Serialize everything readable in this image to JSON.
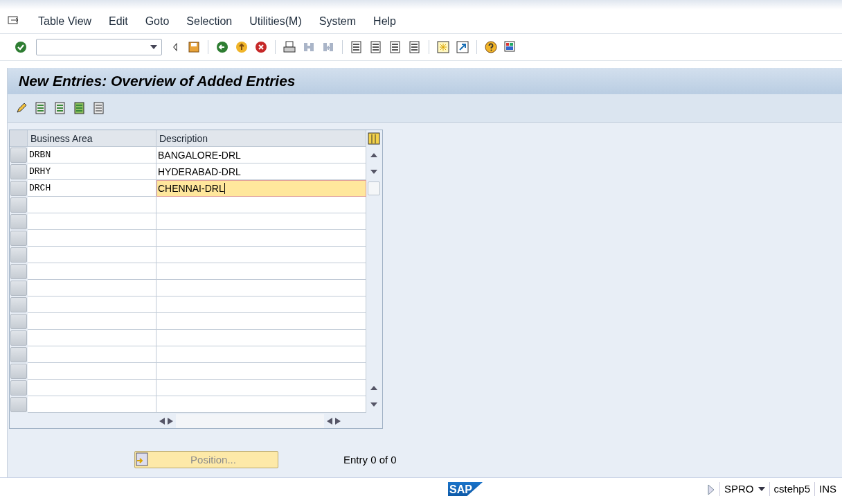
{
  "menu": [
    "Table View",
    "Edit",
    "Goto",
    "Selection",
    "Utilities(M)",
    "System",
    "Help"
  ],
  "title": "New Entries: Overview of Added Entries",
  "table": {
    "columns": [
      "Business Area",
      "Description"
    ],
    "rows": [
      {
        "cells": [
          "DRBN",
          "BANGALORE-DRL"
        ],
        "selected": false
      },
      {
        "cells": [
          "DRHY",
          "HYDERABAD-DRL"
        ],
        "selected": false
      },
      {
        "cells": [
          "DRCH",
          "CHENNAI-DRL"
        ],
        "selected": true
      }
    ]
  },
  "position_button": "Position...",
  "entry_info": "Entry 0 of 0",
  "status_bar": {
    "logo": "SAP",
    "transaction": "SPRO",
    "server": "cstehp5",
    "mode": "INS"
  }
}
